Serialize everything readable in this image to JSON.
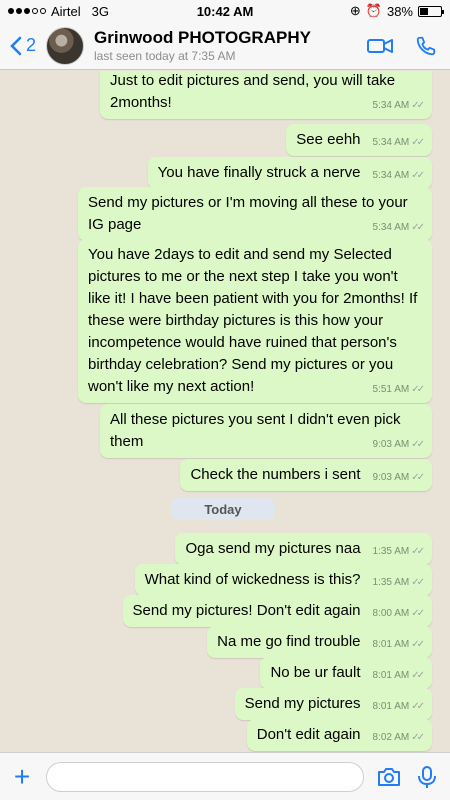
{
  "status_bar": {
    "carrier": "Airtel",
    "network": "3G",
    "time": "10:42 AM",
    "battery": "38%",
    "battery_level": 0.38
  },
  "header": {
    "back_count": "2",
    "contact_name": "Grinwood PHOTOGRAPHY",
    "last_seen": "last seen today at 7:35 AM"
  },
  "messages": [
    {
      "text": "Just to edit pictures and send, you will take 2months!",
      "time": "5:34 AM"
    },
    {
      "text": "See eehh",
      "time": "5:34 AM"
    },
    {
      "text": "You have finally struck a nerve",
      "time": "5:34 AM"
    },
    {
      "text": "Send my pictures or I'm moving all these to your IG page",
      "time": "5:34 AM"
    },
    {
      "text": "You have 2days to edit and send my Selected pictures to me or the next step I take you won't like it! I have been patient with you for 2months! If these were birthday pictures is this how your incompetence would have ruined that person's birthday celebration? Send my pictures or you won't like my next action!",
      "time": "5:51 AM"
    },
    {
      "text": "All these pictures you sent I didn't even pick them",
      "time": "9:03 AM"
    },
    {
      "text": "Check the numbers i sent",
      "time": "9:03 AM"
    },
    {
      "text": "Oga send my pictures naa",
      "time": "1:35 AM"
    },
    {
      "text": "What kind of wickedness is this?",
      "time": "1:35 AM"
    },
    {
      "text": "Send my pictures! Don't edit again",
      "time": "8:00 AM"
    },
    {
      "text": "Na me go find trouble",
      "time": "8:01 AM"
    },
    {
      "text": "No be ur fault",
      "time": "8:01 AM"
    },
    {
      "text": "Send my pictures",
      "time": "8:01 AM"
    },
    {
      "text": "Don't edit again",
      "time": "8:02 AM"
    }
  ],
  "day_divider": "Today",
  "icons": {
    "back": "chevron-left-icon",
    "video": "video-camera-icon",
    "call": "phone-icon",
    "attach": "plus-icon",
    "camera": "camera-icon",
    "mic": "microphone-icon"
  },
  "colors": {
    "accent": "#1f7df5",
    "bubble": "#dcf8c6",
    "chat_bg": "#e9e2d6"
  }
}
